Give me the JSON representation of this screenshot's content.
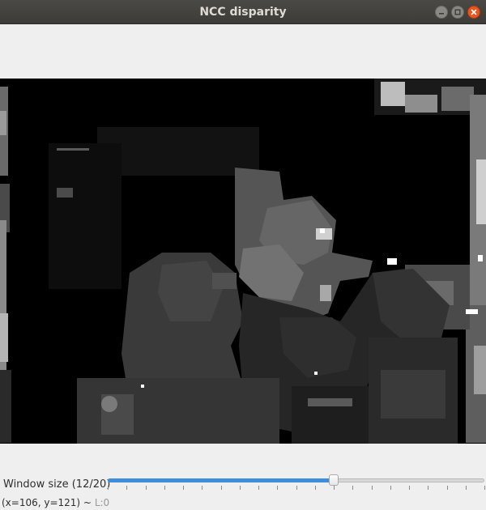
{
  "window": {
    "title": "NCC disparity",
    "controls": [
      "minimize-icon",
      "maximize-icon",
      "close-icon"
    ],
    "close_color": "#e9561e"
  },
  "image": {
    "description_colors": [
      "#000000",
      "#3a3a3a",
      "#6e6e6e",
      "#ffffff"
    ]
  },
  "trackbar": {
    "label": "Window size (12/20)",
    "value": 12,
    "max": 20,
    "fill_color": "#3f8ede"
  },
  "status": {
    "coords": "(x=106, y=121) ~",
    "level": "L:0"
  }
}
